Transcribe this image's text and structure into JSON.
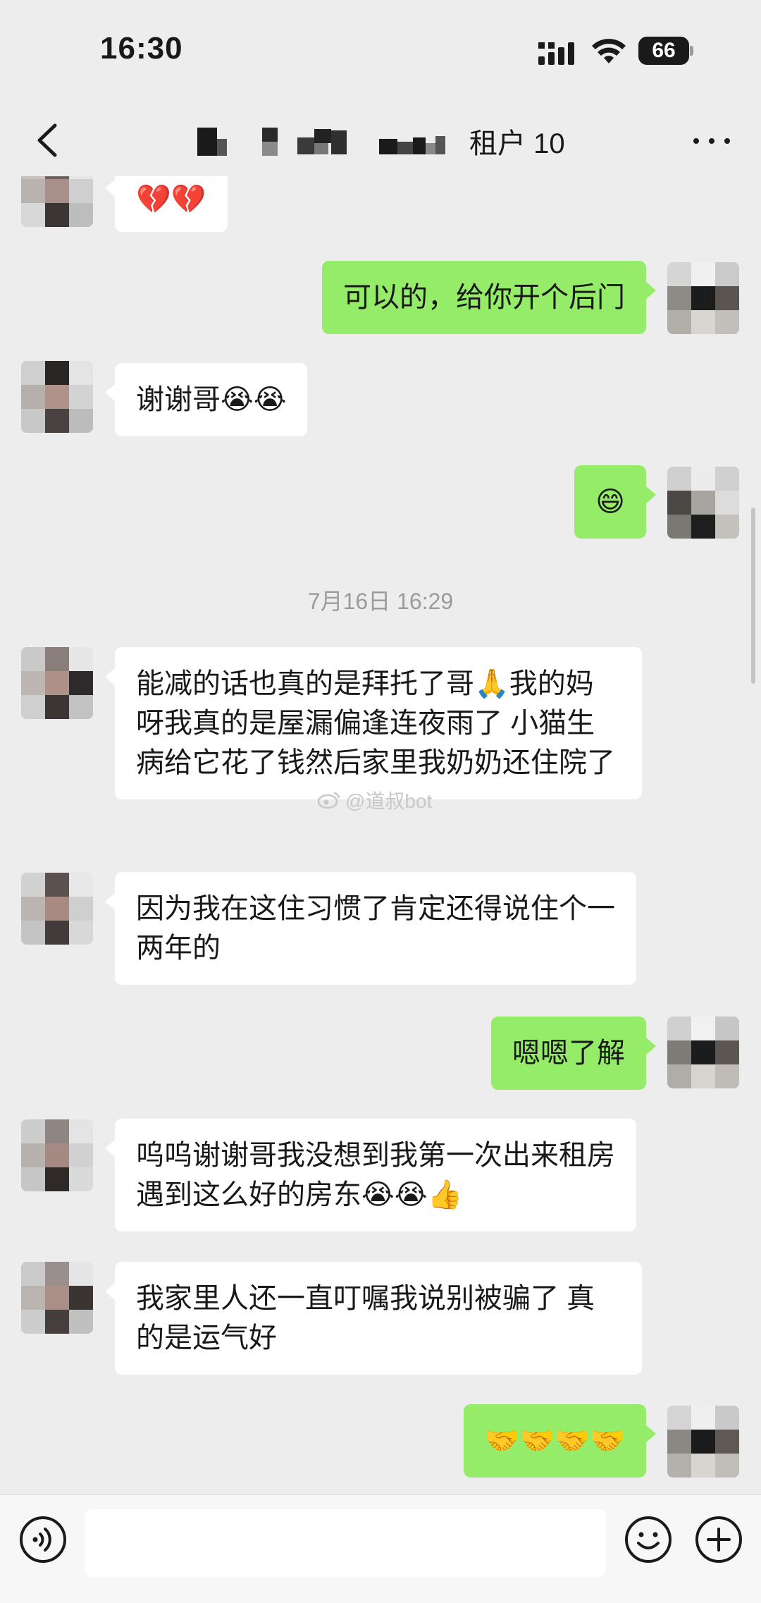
{
  "status_bar": {
    "time": "16:30",
    "battery": "66"
  },
  "nav": {
    "title": "租户 10"
  },
  "messages": {
    "m0": "💔💔",
    "m1": "可以的，给你开个后门",
    "m2": "谢谢哥😭😭",
    "m3": "😄",
    "timestamp": "7月16日 16:29",
    "m4": "能减的话也真的是拜托了哥🙏我的妈呀我真的是屋漏偏逢连夜雨了 小猫生病给它花了钱然后家里我奶奶还住院了",
    "m5": "因为我在这住习惯了肯定还得说住个一两年的",
    "m6": "嗯嗯了解",
    "m7": "呜呜谢谢哥我没想到我第一次出来租房遇到这么好的房东😭😭👍",
    "m8": "我家里人还一直叮嘱我说别被骗了 真的是运气好",
    "m9": "🤝🤝🤝🤝"
  },
  "watermark": "@道叔bot",
  "input": {
    "placeholder": ""
  },
  "colors": {
    "background": "#ededed",
    "outgoing_bubble": "#95ec69",
    "incoming_bubble": "#ffffff"
  },
  "icons": [
    "back-icon",
    "more-icon",
    "signal-icon",
    "wifi-icon",
    "battery-icon",
    "voice-icon",
    "emoji-icon",
    "plus-icon"
  ]
}
